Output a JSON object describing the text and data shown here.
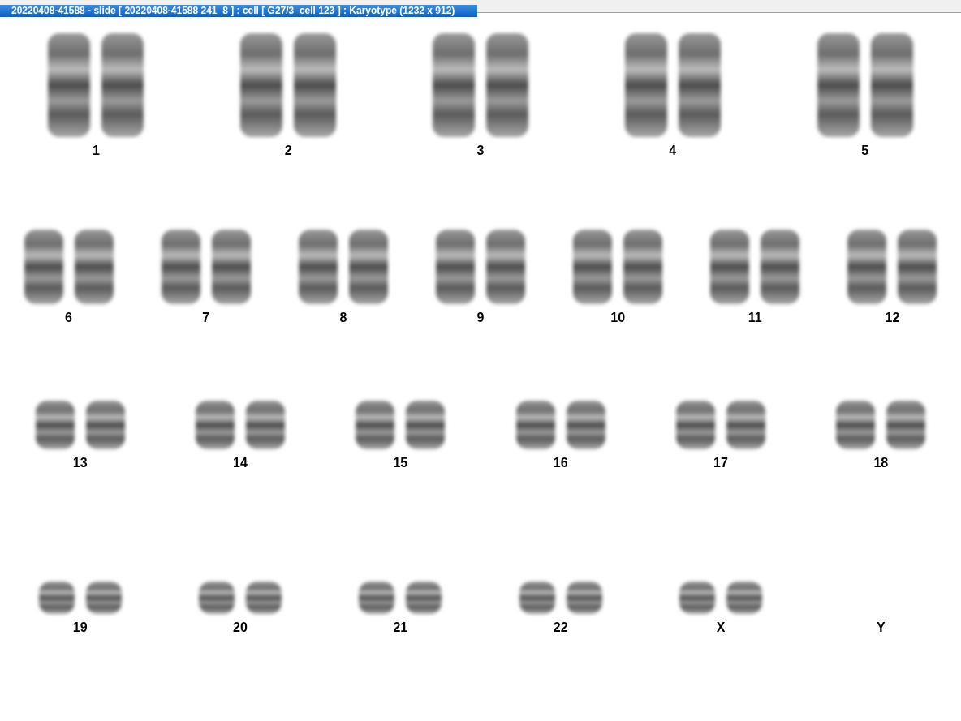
{
  "window": {
    "title": "20220408-41588 - slide [ 20220408-41588 241_8 ] : cell [ G27/3_cell 123 ] : Karyotype  (1232 x 912)"
  },
  "karyotype": {
    "rows": [
      {
        "pairs": [
          {
            "label": "1",
            "kind": "pair"
          },
          {
            "label": "2",
            "kind": "pair"
          },
          {
            "label": "3",
            "kind": "pair"
          },
          {
            "label": "4",
            "kind": "pair"
          },
          {
            "label": "5",
            "kind": "pair"
          }
        ]
      },
      {
        "pairs": [
          {
            "label": "6",
            "kind": "pair"
          },
          {
            "label": "7",
            "kind": "pair"
          },
          {
            "label": "8",
            "kind": "pair"
          },
          {
            "label": "9",
            "kind": "pair"
          },
          {
            "label": "10",
            "kind": "pair"
          },
          {
            "label": "11",
            "kind": "pair"
          },
          {
            "label": "12",
            "kind": "pair"
          }
        ]
      },
      {
        "pairs": [
          {
            "label": "13",
            "kind": "pair"
          },
          {
            "label": "14",
            "kind": "pair"
          },
          {
            "label": "15",
            "kind": "pair"
          },
          {
            "label": "16",
            "kind": "pair"
          },
          {
            "label": "17",
            "kind": "pair"
          },
          {
            "label": "18",
            "kind": "pair"
          }
        ]
      },
      {
        "pairs": [
          {
            "label": "19",
            "kind": "pair"
          },
          {
            "label": "20",
            "kind": "pair"
          },
          {
            "label": "21",
            "kind": "pair"
          },
          {
            "label": "22",
            "kind": "pair"
          },
          {
            "label": "X",
            "kind": "pair"
          },
          {
            "label": "Y",
            "kind": "empty"
          }
        ]
      }
    ]
  }
}
